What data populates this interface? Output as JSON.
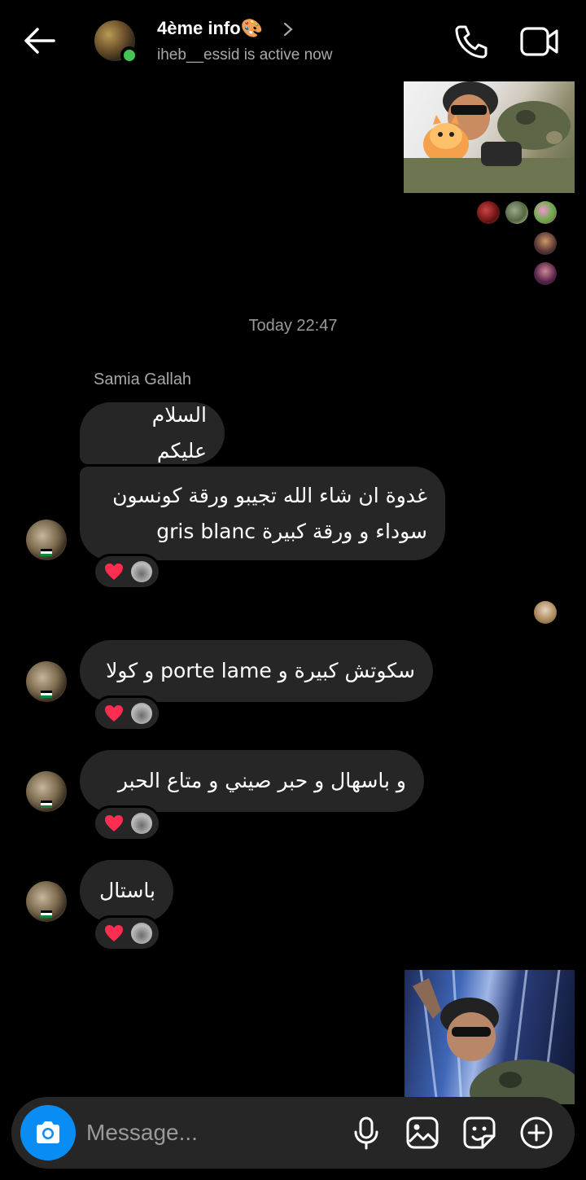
{
  "header": {
    "title": "4ème info",
    "title_emoji": "🎨",
    "subtitle": "iheb__essid is active now"
  },
  "timestamp": "Today 22:47",
  "sender_name": "Samia Gallah",
  "messages": [
    {
      "text": "السلام عليكم"
    },
    {
      "text": "غدوة ان شاء الله تجيبو ورقة كونسون\nسوداء و ورقة كبيرة gris blanc",
      "reaction": "heart"
    },
    {
      "text": "سكوتش كبيرة و porte lame و كولا",
      "reaction": "heart"
    },
    {
      "text": "و باسهال و حبر صيني و  متاع الحبر",
      "reaction": "heart"
    },
    {
      "text": "باستال",
      "reaction": "heart"
    }
  ],
  "composer": {
    "placeholder": "Message..."
  },
  "icons": [
    "back-arrow-icon",
    "chevron-right-icon",
    "phone-icon",
    "video-camera-icon",
    "camera-icon",
    "microphone-icon",
    "image-icon",
    "sticker-icon",
    "plus-circle-icon",
    "heart-icon"
  ],
  "colors": {
    "background": "#000000",
    "bubble": "#262626",
    "accent": "#0a8cf5",
    "online": "#44c553",
    "heart": "#ff2d4f"
  }
}
